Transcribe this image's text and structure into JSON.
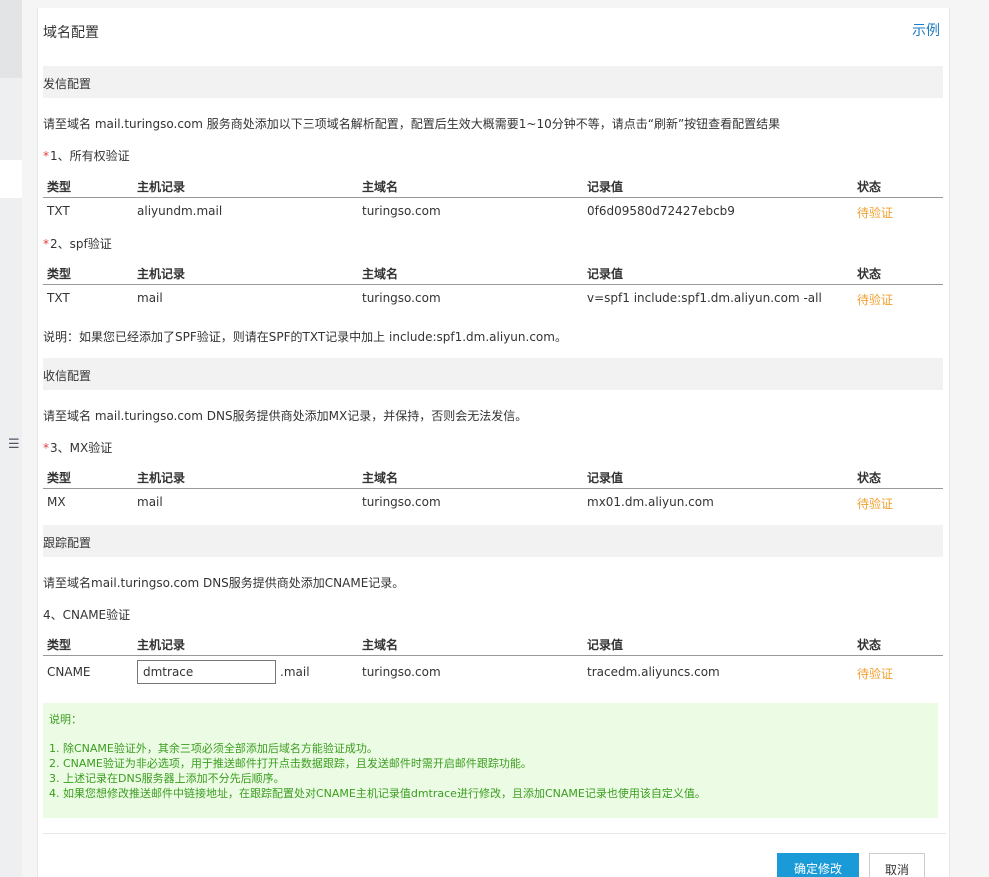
{
  "header": {
    "title": "域名配置",
    "example_link": "示例"
  },
  "send_section": {
    "title": "发信配置",
    "intro": "请至域名 mail.turingso.com 服务商处添加以下三项域名解析配置，配置后生效大概需要1~10分钟不等，请点击“刷新”按钮查看配置结果"
  },
  "columns": {
    "type": "类型",
    "host": "主机记录",
    "domain": "主域名",
    "value": "记录值",
    "status": "状态"
  },
  "ownership": {
    "label": "1、所有权验证",
    "row": {
      "type": "TXT",
      "host": "aliyundm.mail",
      "domain": "turingso.com",
      "value": "0f6d09580d72427ebcb9",
      "status": "待验证"
    }
  },
  "spf": {
    "label": "2、spf验证",
    "row": {
      "type": "TXT",
      "host": "mail",
      "domain": "turingso.com",
      "value": "v=spf1 include:spf1.dm.aliyun.com -all",
      "status": "待验证"
    },
    "note": "说明：如果您已经添加了SPF验证，则请在SPF的TXT记录中加上 include:spf1.dm.aliyun.com。"
  },
  "receive_section": {
    "title": "收信配置",
    "intro": "请至域名 mail.turingso.com DNS服务提供商处添加MX记录，并保持，否则会无法发信。"
  },
  "mx": {
    "label": "3、MX验证",
    "row": {
      "type": "MX",
      "host": "mail",
      "domain": "turingso.com",
      "value": "mx01.dm.aliyun.com",
      "status": "待验证"
    }
  },
  "track_section": {
    "title": "跟踪配置",
    "intro": "请至域名mail.turingso.com DNS服务提供商处添加CNAME记录。"
  },
  "cname": {
    "label": "4、CNAME验证",
    "row": {
      "type": "CNAME",
      "host_value": "dmtrace",
      "host_suffix": ".mail",
      "domain": "turingso.com",
      "value": "tracedm.aliyuncs.com",
      "status": "待验证"
    }
  },
  "notes": {
    "title": "说明：",
    "items": [
      "1. 除CNAME验证外，其余三项必须全部添加后域名方能验证成功。",
      "2. CNAME验证为非必选项，用于推送邮件打开点击数据跟踪，且发送邮件时需开启邮件跟踪功能。",
      "3. 上述记录在DNS服务器上添加不分先后顺序。",
      "4. 如果您想修改推送邮件中链接地址，在跟踪配置处对CNAME主机记录值dmtrace进行修改，且添加CNAME记录也使用该自定义值。"
    ]
  },
  "footer": {
    "confirm_label": "确定修改",
    "cancel_label": "取消"
  },
  "icons": {
    "sidebar_toggle": "menu-icon"
  }
}
